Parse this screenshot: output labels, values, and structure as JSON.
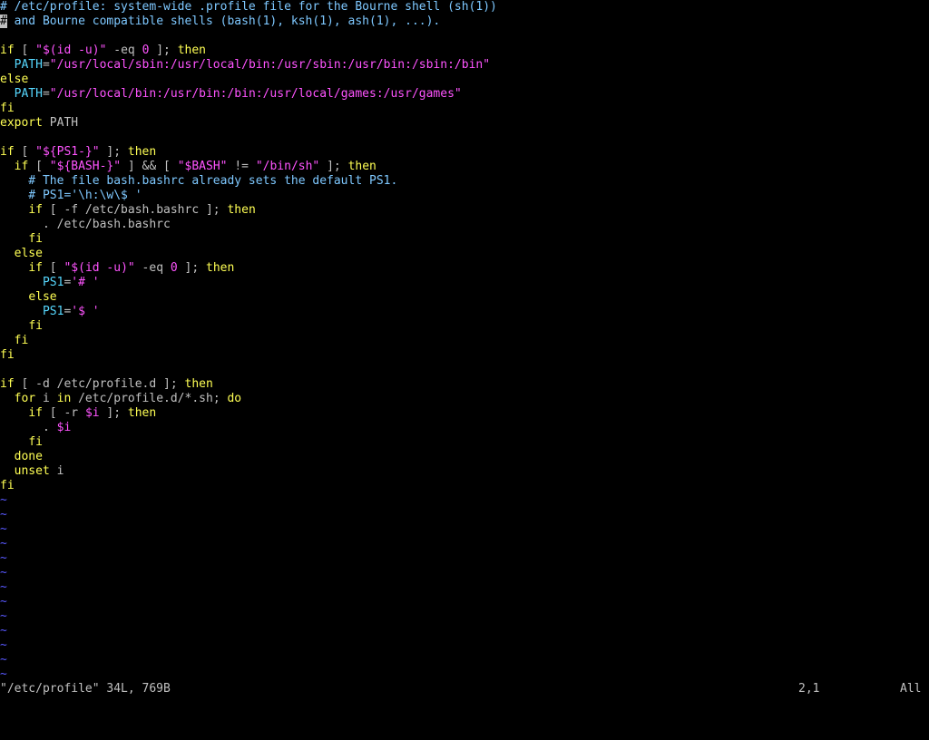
{
  "colors": {
    "background": "#000000",
    "normal": "#c0c0c0",
    "comment": "#7ec8ff",
    "keyword": "#ffff54",
    "variable": "#56d8ff",
    "special": "#ff54ff",
    "string": "#ff54ff",
    "number": "#ff54ff",
    "nontext": "#5858ff",
    "cursor_bg": "#c0c0c0",
    "cursor_fg": "#000000"
  },
  "lines": [
    [
      {
        "t": "# /etc/profile: system-wide .profile file for the Bourne shell (sh(1))",
        "c": "comment"
      }
    ],
    [
      {
        "t": "#",
        "c": "cursor"
      },
      {
        "t": " and Bourne compatible shells (bash(1), ksh(1), ash(1), ...).",
        "c": "comment"
      }
    ],
    [],
    [
      {
        "t": "if",
        "c": "keyword"
      },
      {
        "t": " [ ",
        "c": "normal"
      },
      {
        "t": "\"",
        "c": "string"
      },
      {
        "t": "$(",
        "c": "special"
      },
      {
        "t": "id -u",
        "c": "special"
      },
      {
        "t": ")",
        "c": "special"
      },
      {
        "t": "\"",
        "c": "string"
      },
      {
        "t": " -eq ",
        "c": "normal"
      },
      {
        "t": "0",
        "c": "number"
      },
      {
        "t": " ]; ",
        "c": "normal"
      },
      {
        "t": "then",
        "c": "keyword"
      }
    ],
    [
      {
        "t": "  ",
        "c": "normal"
      },
      {
        "t": "PATH",
        "c": "variable"
      },
      {
        "t": "=",
        "c": "normal"
      },
      {
        "t": "\"/usr/local/sbin:/usr/local/bin:/usr/sbin:/usr/bin:/sbin:/bin\"",
        "c": "string"
      }
    ],
    [
      {
        "t": "else",
        "c": "keyword"
      }
    ],
    [
      {
        "t": "  ",
        "c": "normal"
      },
      {
        "t": "PATH",
        "c": "variable"
      },
      {
        "t": "=",
        "c": "normal"
      },
      {
        "t": "\"/usr/local/bin:/usr/bin:/bin:/usr/local/games:/usr/games\"",
        "c": "string"
      }
    ],
    [
      {
        "t": "fi",
        "c": "keyword"
      }
    ],
    [
      {
        "t": "export",
        "c": "keyword"
      },
      {
        "t": " PATH",
        "c": "normal"
      }
    ],
    [],
    [
      {
        "t": "if",
        "c": "keyword"
      },
      {
        "t": " [ ",
        "c": "normal"
      },
      {
        "t": "\"",
        "c": "string"
      },
      {
        "t": "${PS1-}",
        "c": "special"
      },
      {
        "t": "\"",
        "c": "string"
      },
      {
        "t": " ]; ",
        "c": "normal"
      },
      {
        "t": "then",
        "c": "keyword"
      }
    ],
    [
      {
        "t": "  ",
        "c": "normal"
      },
      {
        "t": "if",
        "c": "keyword"
      },
      {
        "t": " [ ",
        "c": "normal"
      },
      {
        "t": "\"",
        "c": "string"
      },
      {
        "t": "${BASH-}",
        "c": "special"
      },
      {
        "t": "\"",
        "c": "string"
      },
      {
        "t": " ] && [ ",
        "c": "normal"
      },
      {
        "t": "\"",
        "c": "string"
      },
      {
        "t": "$BASH",
        "c": "special"
      },
      {
        "t": "\"",
        "c": "string"
      },
      {
        "t": " != ",
        "c": "normal"
      },
      {
        "t": "\"/bin/sh\"",
        "c": "string"
      },
      {
        "t": " ]; ",
        "c": "normal"
      },
      {
        "t": "then",
        "c": "keyword"
      }
    ],
    [
      {
        "t": "    # The file bash.bashrc already sets the default PS1.",
        "c": "comment"
      }
    ],
    [
      {
        "t": "    # PS1='\\h:\\w\\$ '",
        "c": "comment"
      }
    ],
    [
      {
        "t": "    ",
        "c": "normal"
      },
      {
        "t": "if",
        "c": "keyword"
      },
      {
        "t": " [ -f /etc/bash.bashrc ]; ",
        "c": "normal"
      },
      {
        "t": "then",
        "c": "keyword"
      }
    ],
    [
      {
        "t": "      . /etc/bash.bashrc",
        "c": "normal"
      }
    ],
    [
      {
        "t": "    ",
        "c": "normal"
      },
      {
        "t": "fi",
        "c": "keyword"
      }
    ],
    [
      {
        "t": "  ",
        "c": "normal"
      },
      {
        "t": "else",
        "c": "keyword"
      }
    ],
    [
      {
        "t": "    ",
        "c": "normal"
      },
      {
        "t": "if",
        "c": "keyword"
      },
      {
        "t": " [ ",
        "c": "normal"
      },
      {
        "t": "\"",
        "c": "string"
      },
      {
        "t": "$(",
        "c": "special"
      },
      {
        "t": "id -u",
        "c": "special"
      },
      {
        "t": ")",
        "c": "special"
      },
      {
        "t": "\"",
        "c": "string"
      },
      {
        "t": " -eq ",
        "c": "normal"
      },
      {
        "t": "0",
        "c": "number"
      },
      {
        "t": " ]; ",
        "c": "normal"
      },
      {
        "t": "then",
        "c": "keyword"
      }
    ],
    [
      {
        "t": "      ",
        "c": "normal"
      },
      {
        "t": "PS1",
        "c": "variable"
      },
      {
        "t": "=",
        "c": "normal"
      },
      {
        "t": "'# '",
        "c": "string"
      }
    ],
    [
      {
        "t": "    ",
        "c": "normal"
      },
      {
        "t": "else",
        "c": "keyword"
      }
    ],
    [
      {
        "t": "      ",
        "c": "normal"
      },
      {
        "t": "PS1",
        "c": "variable"
      },
      {
        "t": "=",
        "c": "normal"
      },
      {
        "t": "'$ '",
        "c": "string"
      }
    ],
    [
      {
        "t": "    ",
        "c": "normal"
      },
      {
        "t": "fi",
        "c": "keyword"
      }
    ],
    [
      {
        "t": "  ",
        "c": "normal"
      },
      {
        "t": "fi",
        "c": "keyword"
      }
    ],
    [
      {
        "t": "fi",
        "c": "keyword"
      }
    ],
    [],
    [
      {
        "t": "if",
        "c": "keyword"
      },
      {
        "t": " [ -d /etc/profile.d ]; ",
        "c": "normal"
      },
      {
        "t": "then",
        "c": "keyword"
      }
    ],
    [
      {
        "t": "  ",
        "c": "normal"
      },
      {
        "t": "for",
        "c": "keyword"
      },
      {
        "t": " i ",
        "c": "normal"
      },
      {
        "t": "in",
        "c": "keyword"
      },
      {
        "t": " /etc/profile.d/*.sh; ",
        "c": "normal"
      },
      {
        "t": "do",
        "c": "keyword"
      }
    ],
    [
      {
        "t": "    ",
        "c": "normal"
      },
      {
        "t": "if",
        "c": "keyword"
      },
      {
        "t": " [ -r ",
        "c": "normal"
      },
      {
        "t": "$i",
        "c": "special"
      },
      {
        "t": " ]; ",
        "c": "normal"
      },
      {
        "t": "then",
        "c": "keyword"
      }
    ],
    [
      {
        "t": "      . ",
        "c": "normal"
      },
      {
        "t": "$i",
        "c": "special"
      }
    ],
    [
      {
        "t": "    ",
        "c": "normal"
      },
      {
        "t": "fi",
        "c": "keyword"
      }
    ],
    [
      {
        "t": "  ",
        "c": "normal"
      },
      {
        "t": "done",
        "c": "keyword"
      }
    ],
    [
      {
        "t": "  ",
        "c": "normal"
      },
      {
        "t": "unset",
        "c": "keyword"
      },
      {
        "t": " i",
        "c": "normal"
      }
    ],
    [
      {
        "t": "fi",
        "c": "keyword"
      }
    ]
  ],
  "tilde_lines": [
    "~",
    "~",
    "~",
    "~",
    "~",
    "~",
    "~",
    "~",
    "~",
    "~",
    "~",
    "~",
    "~"
  ],
  "status": {
    "file_info": "\"/etc/profile\" 34L, 769B",
    "cursor_position": "2,1",
    "scroll_position": "All"
  }
}
